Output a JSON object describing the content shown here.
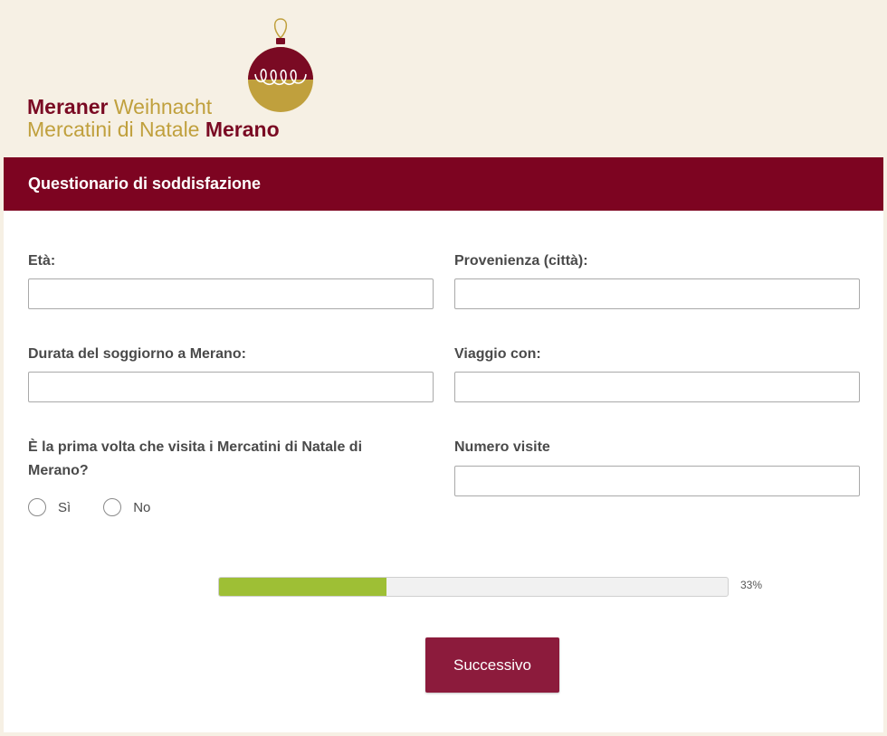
{
  "brand": {
    "line1_a": "Meraner",
    "line1_b": "Weihnacht",
    "line2_a": "Mercatini di Natale",
    "line2_b": "Merano",
    "colors": {
      "wine": "#7a0a23",
      "gold": "#c0a03d"
    }
  },
  "survey": {
    "title": "Questionario di soddisfazione",
    "fields": {
      "age_label": "Età:",
      "age_value": "",
      "origin_label": "Provenienza (città):",
      "origin_value": "",
      "stay_label": "Durata del soggiorno a Merano:",
      "stay_value": "",
      "travel_label": "Viaggio con:",
      "travel_value": "",
      "first_visit_label": "È la prima volta che visita i Mercatini di Natale di Merano?",
      "first_visit_options": [
        "Sì",
        "No"
      ],
      "visits_label": "Numero visite",
      "visits_value": ""
    },
    "progress": {
      "fraction": 0.33,
      "text": "33%",
      "color": "#9ebf35"
    },
    "next_label": "Successivo"
  },
  "colors": {
    "header_bg": "#7d0421",
    "button_bg": "#8c1b3c",
    "page_bg": "#f6f0e4"
  }
}
